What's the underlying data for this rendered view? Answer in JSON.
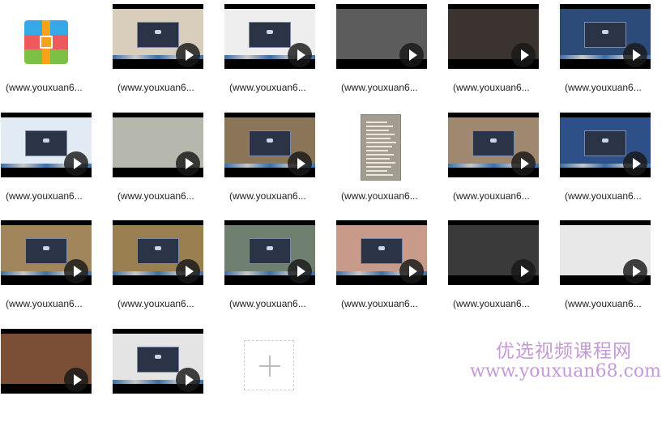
{
  "files": [
    {
      "label": "(www.youxuan6...",
      "kind": "archive",
      "icon": "zip-archive-icon"
    },
    {
      "label": "(www.youxuan6...",
      "kind": "video",
      "bg": "#d9cdbb",
      "win": true
    },
    {
      "label": "(www.youxuan6...",
      "kind": "video",
      "bg": "#eeeeee",
      "win": true
    },
    {
      "label": "(www.youxuan6...",
      "kind": "video",
      "bg": "#5c5c5c",
      "win": false
    },
    {
      "label": "(www.youxuan6...",
      "kind": "video",
      "bg": "#3a3330",
      "win": false
    },
    {
      "label": "(www.youxuan6...",
      "kind": "video",
      "bg": "#2d4b78",
      "win": true
    },
    {
      "label": "(www.youxuan6...",
      "kind": "video",
      "bg": "#e2ebf4",
      "win": true
    },
    {
      "label": "(www.youxuan6...",
      "kind": "video",
      "bg": "#b6b8ae",
      "win": false
    },
    {
      "label": "(www.youxuan6...",
      "kind": "video",
      "bg": "#8b7558",
      "win": true
    },
    {
      "label": "(www.youxuan6...",
      "kind": "document",
      "icon": "text-document-icon"
    },
    {
      "label": "(www.youxuan6...",
      "kind": "video",
      "bg": "#a08870",
      "win": true
    },
    {
      "label": "(www.youxuan6...",
      "kind": "video",
      "bg": "#2e5088",
      "win": true
    },
    {
      "label": "(www.youxuan6...",
      "kind": "video",
      "bg": "#a0865a",
      "win": true
    },
    {
      "label": "(www.youxuan6...",
      "kind": "video",
      "bg": "#9a8050",
      "win": true
    },
    {
      "label": "(www.youxuan6...",
      "kind": "video",
      "bg": "#6f8070",
      "win": true
    },
    {
      "label": "(www.youxuan6...",
      "kind": "video",
      "bg": "#c79a8a",
      "win": true
    },
    {
      "label": "(www.youxuan6...",
      "kind": "video",
      "bg": "#3a3a3a",
      "win": false
    },
    {
      "label": "(www.youxuan6...",
      "kind": "video",
      "bg": "#e8e8e8",
      "win": false
    },
    {
      "label": "",
      "kind": "video",
      "bg": "#7a4f35",
      "win": false
    },
    {
      "label": "",
      "kind": "video",
      "bg": "#e4e4e4",
      "win": true
    }
  ],
  "add_tile": {
    "icon": "plus-icon"
  },
  "watermark": {
    "line1": "优选视频课程网",
    "line2": "www.youxuan68.com"
  },
  "colors": {
    "watermark": "#c59ad6",
    "play_overlay": "#191919"
  }
}
